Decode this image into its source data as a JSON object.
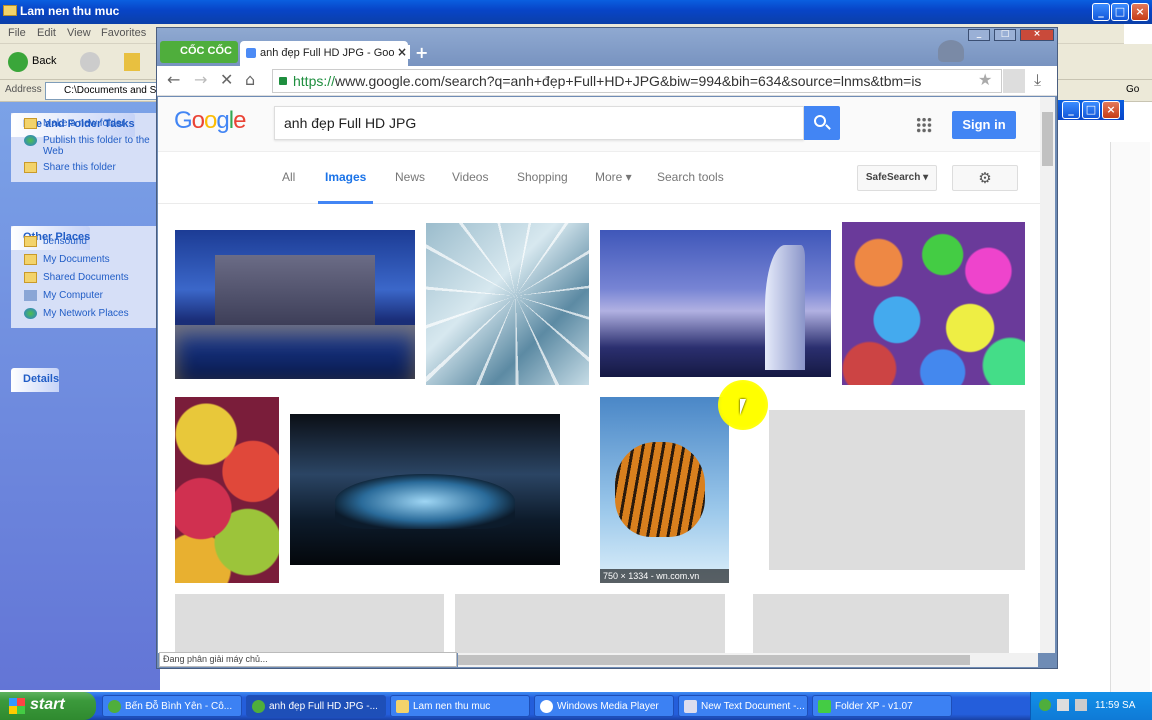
{
  "xp_window": {
    "title": "Lam nen thu muc",
    "menu": [
      "File",
      "Edit",
      "View",
      "Favorites"
    ],
    "back_label": "Back",
    "address_label": "Address",
    "address_value": "C:\\Documents and Se",
    "go_label": "Go"
  },
  "sidebar": {
    "tasks_header": "File and Folder Tasks",
    "tasks": [
      "Make a new folder",
      "Publish this folder to the Web",
      "Share this folder"
    ],
    "places_header": "Other Places",
    "places": [
      "bensound",
      "My Documents",
      "Shared Documents",
      "My Computer",
      "My Network Places"
    ],
    "details_header": "Details"
  },
  "browser": {
    "logo": "CỐC CỐC",
    "tab_title": "anh đẹp Full HD JPG - Google",
    "url_scheme": "https://",
    "url_rest": "www.google.com/search?q=anh+đẹp+Full+HD+JPG&biw=994&bih=634&source=lnms&tbm=is",
    "status_text": "Đang phân giải máy chủ..."
  },
  "google": {
    "query": "anh đẹp Full HD JPG",
    "signin": "Sign in",
    "tabs": [
      "All",
      "Images",
      "News",
      "Videos",
      "Shopping",
      "More ▾",
      "Search tools"
    ],
    "safesearch": "SafeSearch ▾",
    "image_caption": "750 × 1334 - wn.com.vn"
  },
  "taskbar": {
    "start": "start",
    "items": [
      "Bến Đỗ Bình Yên - Cô...",
      "anh đẹp Full HD JPG -...",
      "Lam nen thu muc",
      "Windows Media Player",
      "New Text Document -...",
      "Folder XP - v1.07"
    ],
    "clock": "11:59 SA"
  }
}
